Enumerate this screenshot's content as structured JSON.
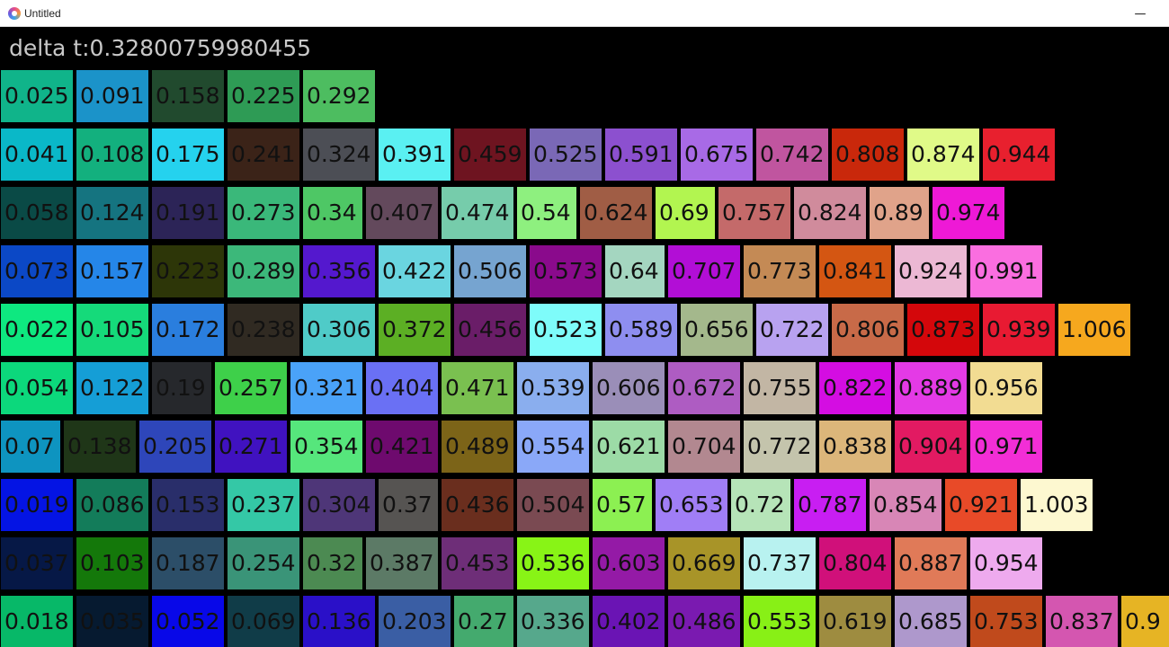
{
  "window": {
    "title": "Untitled",
    "minimize_glyph": "—"
  },
  "delta": "delta t:0.32800759980455",
  "rows": [
    [
      [
        "0.025",
        "#10b48a"
      ],
      [
        "0.091",
        "#1b93c9"
      ],
      [
        "0.158",
        "#214a2e"
      ],
      [
        "0.225",
        "#2e9b55"
      ],
      [
        "0.292",
        "#4dbd60"
      ]
    ],
    [
      [
        "0.041",
        "#0ab8c8"
      ],
      [
        "0.108",
        "#13b07e"
      ],
      [
        "0.175",
        "#25d2ee"
      ],
      [
        "0.241",
        "#3b2318"
      ],
      [
        "0.324",
        "#4c4e55"
      ],
      [
        "0.391",
        "#5af0f2"
      ],
      [
        "0.459",
        "#6e1420"
      ],
      [
        "0.525",
        "#7a68b6"
      ],
      [
        "0.591",
        "#8c50cf"
      ],
      [
        "0.675",
        "#a86ae6"
      ],
      [
        "0.742",
        "#c0559f"
      ],
      [
        "0.808",
        "#c9280b"
      ],
      [
        "0.874",
        "#e0fa88"
      ],
      [
        "0.944",
        "#e8202e"
      ]
    ],
    [
      [
        "0.058",
        "#0a4a46"
      ],
      [
        "0.124",
        "#157480"
      ],
      [
        "0.191",
        "#2c2457"
      ],
      [
        "0.273",
        "#3ab87a"
      ],
      [
        "0.34",
        "#4ec765"
      ],
      [
        "0.407",
        "#63495c"
      ],
      [
        "0.474",
        "#76ccab"
      ],
      [
        "0.54",
        "#8ef07f"
      ],
      [
        "0.624",
        "#a05d45"
      ],
      [
        "0.69",
        "#b2f550"
      ],
      [
        "0.757",
        "#c46a6a"
      ],
      [
        "0.824",
        "#d08b9c"
      ],
      [
        "0.89",
        "#e0a38a"
      ],
      [
        "0.974",
        "#ee19d6"
      ]
    ],
    [
      [
        "0.073",
        "#0b48c6"
      ],
      [
        "0.157",
        "#2586e8"
      ],
      [
        "0.223",
        "#2d3608"
      ],
      [
        "0.289",
        "#3cb87a"
      ],
      [
        "0.356",
        "#5418ce"
      ],
      [
        "0.422",
        "#6ad5e0"
      ],
      [
        "0.506",
        "#76a4d0"
      ],
      [
        "0.573",
        "#8a0a8c"
      ],
      [
        "0.64",
        "#a4d6c0"
      ],
      [
        "0.707",
        "#b20ed6"
      ],
      [
        "0.773",
        "#c48a55"
      ],
      [
        "0.841",
        "#d45612"
      ],
      [
        "0.924",
        "#ecb8d4"
      ],
      [
        "0.991",
        "#fa6ee0"
      ]
    ],
    [
      [
        "0.022",
        "#0ee880"
      ],
      [
        "0.105",
        "#15da7a"
      ],
      [
        "0.172",
        "#2a7ede"
      ],
      [
        "0.238",
        "#302a22"
      ],
      [
        "0.306",
        "#4fcbc8"
      ],
      [
        "0.372",
        "#5caf24"
      ],
      [
        "0.456",
        "#6a1d68"
      ],
      [
        "0.523",
        "#7efcfa"
      ],
      [
        "0.589",
        "#8e8ef0"
      ],
      [
        "0.656",
        "#a4b88c"
      ],
      [
        "0.722",
        "#b8a2f0"
      ],
      [
        "0.806",
        "#c86a48"
      ],
      [
        "0.873",
        "#d4070b"
      ],
      [
        "0.939",
        "#e81a32"
      ],
      [
        "1.006",
        "#f6a81e"
      ]
    ],
    [
      [
        "0.054",
        "#0cd87c"
      ],
      [
        "0.122",
        "#159ed6"
      ],
      [
        "0.19",
        "#26282c"
      ],
      [
        "0.257",
        "#3ed04a"
      ],
      [
        "0.321",
        "#4aa2f8"
      ],
      [
        "0.404",
        "#6a70f4"
      ],
      [
        "0.471",
        "#7ac050"
      ],
      [
        "0.539",
        "#8aaeee"
      ],
      [
        "0.606",
        "#9a8eb8"
      ],
      [
        "0.672",
        "#ae5cc2"
      ],
      [
        "0.755",
        "#c2b6a4"
      ],
      [
        "0.822",
        "#d40de2"
      ],
      [
        "0.889",
        "#e43ae6"
      ],
      [
        "0.956",
        "#f2dc92"
      ]
    ],
    [
      [
        "0.07",
        "#0e94c0"
      ],
      [
        "0.138",
        "#1f3618"
      ],
      [
        "0.205",
        "#2e46ba"
      ],
      [
        "0.271",
        "#4012c0"
      ],
      [
        "0.354",
        "#56e67c"
      ],
      [
        "0.421",
        "#6e0a6e"
      ],
      [
        "0.489",
        "#7c6418"
      ],
      [
        "0.554",
        "#8aa8f8"
      ],
      [
        "0.621",
        "#9cdba6"
      ],
      [
        "0.704",
        "#b28890"
      ],
      [
        "0.772",
        "#c4c4ac"
      ],
      [
        "0.838",
        "#dcb67a"
      ],
      [
        "0.904",
        "#e21a62"
      ],
      [
        "0.971",
        "#f22ed6"
      ]
    ],
    [
      [
        "0.019",
        "#0414e4"
      ],
      [
        "0.086",
        "#137c5a"
      ],
      [
        "0.153",
        "#292e6a"
      ],
      [
        "0.237",
        "#34c8a6"
      ],
      [
        "0.304",
        "#4e3678"
      ],
      [
        "0.37",
        "#565452"
      ],
      [
        "0.436",
        "#6a2e1e"
      ],
      [
        "0.504",
        "#7a4a52"
      ],
      [
        "0.57",
        "#8cf052"
      ],
      [
        "0.653",
        "#a07ef6"
      ],
      [
        "0.72",
        "#b6e4b8"
      ],
      [
        "0.787",
        "#c81ef2"
      ],
      [
        "0.854",
        "#d886b6"
      ],
      [
        "0.921",
        "#e84a28"
      ],
      [
        "1.003",
        "#fdf8d0"
      ]
    ],
    [
      [
        "0.037",
        "#061846"
      ],
      [
        "0.103",
        "#14780a"
      ],
      [
        "0.187",
        "#2c4e68"
      ],
      [
        "0.254",
        "#3a9478"
      ],
      [
        "0.32",
        "#4c8a52"
      ],
      [
        "0.387",
        "#5c7a66"
      ],
      [
        "0.453",
        "#6e2e78"
      ],
      [
        "0.536",
        "#88f416"
      ],
      [
        "0.603",
        "#941aa6"
      ],
      [
        "0.669",
        "#a89428"
      ],
      [
        "0.737",
        "#b8f2f0"
      ],
      [
        "0.804",
        "#d0107a"
      ],
      [
        "0.887",
        "#e07a58"
      ],
      [
        "0.954",
        "#eeaaee"
      ]
    ],
    [
      [
        "0.018",
        "#07b868"
      ],
      [
        "0.035",
        "#061a30"
      ],
      [
        "0.052",
        "#0808e8"
      ],
      [
        "0.069",
        "#103c48"
      ],
      [
        "0.136",
        "#2a10c8"
      ],
      [
        "0.203",
        "#3a5ea4"
      ],
      [
        "0.27",
        "#44aa6e"
      ],
      [
        "0.336",
        "#56a88c"
      ],
      [
        "0.402",
        "#6a14b4"
      ],
      [
        "0.486",
        "#7a1ab0"
      ],
      [
        "0.553",
        "#88f016"
      ],
      [
        "0.619",
        "#9e8c40"
      ],
      [
        "0.685",
        "#ae98cc"
      ],
      [
        "0.753",
        "#c04a1c"
      ],
      [
        "0.837",
        "#d456b0"
      ],
      [
        "0.9",
        "#e6b424"
      ]
    ]
  ]
}
